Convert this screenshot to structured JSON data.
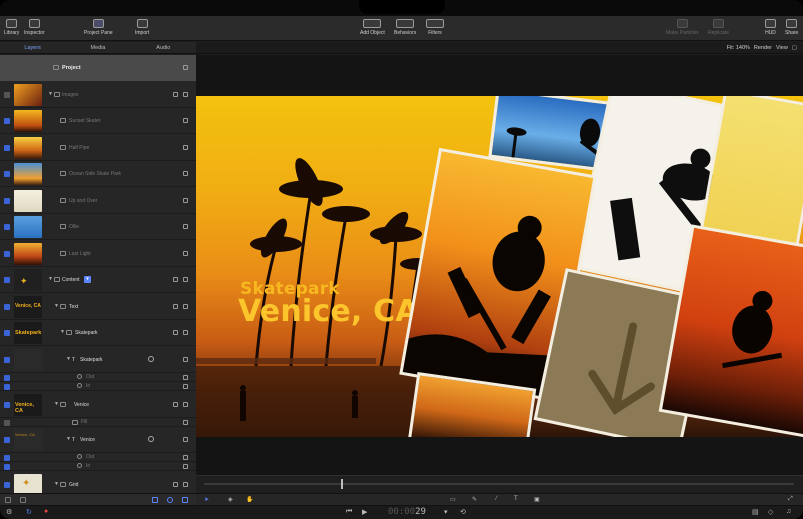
{
  "toolbar": {
    "library": "Library",
    "inspector": "Inspector",
    "project_pane": "Project Pane",
    "import": "Import",
    "add_object": "Add Object",
    "behaviors": "Behaviors",
    "filters": "Filters",
    "make_particles": "Make Particles",
    "replicate": "Replicate",
    "hud": "HUD",
    "share": "Share"
  },
  "tabs": {
    "layers": "Layers",
    "media": "Media",
    "audio": "Audio"
  },
  "view_options": {
    "fit": "Fit: 140%",
    "render": "Render",
    "view": "View"
  },
  "project_label": "Project",
  "layers": [
    {
      "label": "Images",
      "dim": true
    },
    {
      "label": "Sunset Skater",
      "dim": true
    },
    {
      "label": "Half Pipe",
      "dim": true
    },
    {
      "label": "Ocean Side Skate Park",
      "dim": true
    },
    {
      "label": "Up and Over",
      "dim": true
    },
    {
      "label": "Ollie",
      "dim": true
    },
    {
      "label": "Last Light",
      "dim": true
    },
    {
      "label": "Content",
      "dim": false
    },
    {
      "label": "Text",
      "dim": false
    },
    {
      "label": "Skatepark",
      "dim": false
    },
    {
      "label": "Skatepark",
      "dim": false
    },
    {
      "label": "Out",
      "dim": true
    },
    {
      "label": "In",
      "dim": true
    },
    {
      "label": "Venice",
      "dim": false
    },
    {
      "label": "Fill",
      "dim": true
    },
    {
      "label": "Venice",
      "dim": false
    },
    {
      "label": "Out",
      "dim": true
    },
    {
      "label": "In",
      "dim": true
    },
    {
      "label": "Grid",
      "dim": false
    }
  ],
  "thumb_labels": {
    "content": "Venice, CA",
    "skatepark": "Skatepark",
    "venice": "Venice, CA",
    "venice_lower": "Venice, CA"
  },
  "canvas": {
    "title_small": "Skatepark",
    "title_large": "Venice, CA"
  },
  "timecode": {
    "prefix": "00:00",
    "frames": "29"
  },
  "colors": {
    "accent": "#3b64d6",
    "title": "#fbc52b"
  }
}
